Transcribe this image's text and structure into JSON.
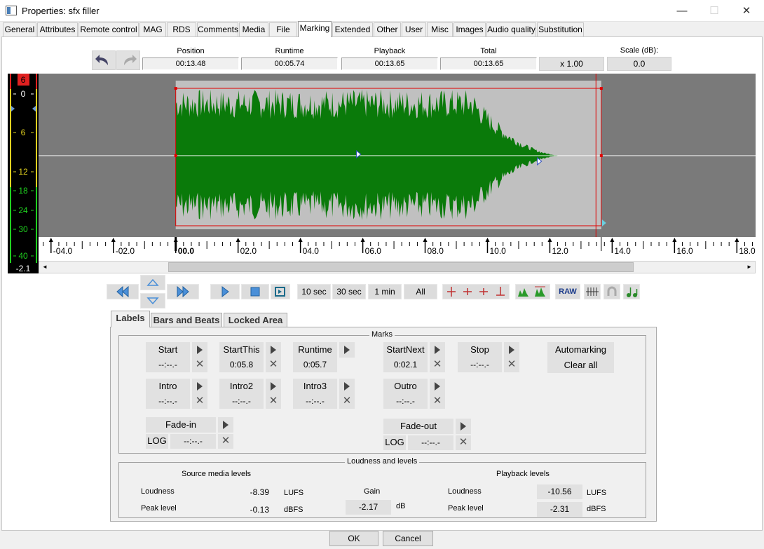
{
  "window": {
    "title": "Properties: sfx filler",
    "min_glyph": "—",
    "max_glyph": "☐",
    "close_glyph": "✕"
  },
  "tabs": [
    "General",
    "Attributes",
    "Remote control",
    "MAG",
    "RDS",
    "Comments",
    "Media",
    "File",
    "Marking",
    "Extended",
    "Other",
    "User",
    "Misc",
    "Images",
    "Audio quality",
    "Substitution"
  ],
  "active_tab": "Marking",
  "toolbar": {
    "undo_icon": "undo-arrow-icon",
    "redo_icon": "redo-arrow-icon",
    "position_label": "Position",
    "position_value": "00:13.48",
    "runtime_label": "Runtime",
    "runtime_value": "00:05.74",
    "playback_label": "Playback",
    "playback_value": "00:13.65",
    "total_label": "Total",
    "total_value": "00:13.65",
    "speed_value": "x 1.00",
    "scale_label": "Scale (dB):",
    "scale_value": "0.0"
  },
  "vu_meter": {
    "top_value": "6",
    "bottom_value": "-2.1",
    "ticks": [
      "0",
      "6",
      "12",
      "18",
      "24",
      "30",
      "40"
    ],
    "colors": {
      "top": "#e02020",
      "mid": "#e0d020",
      "low": "#20d020"
    }
  },
  "waveform": {
    "color": "#0a7a0a",
    "selection_color": "#c0c0c0",
    "outside_color": "#7a7a7a",
    "cursor_color": "#e00000",
    "selection_start_sec": 0.0,
    "selection_end_sec": 13.65,
    "cursor_sec": 13.48,
    "content_end_sec": 12.5,
    "markers_sec": [
      5.8,
      11.6
    ]
  },
  "ruler": {
    "labels": [
      "-04.0",
      "-02.0",
      "00.0",
      "02.0",
      "04.0",
      "06.0",
      "08.0",
      "10.0",
      "12.0",
      "14.0",
      "16.0",
      "18.0"
    ],
    "range_sec": [
      -4.4,
      18.6
    ]
  },
  "scrollbar": {
    "left_arrow": "◄",
    "right_arrow": "►",
    "thumb_start": 0.17,
    "thumb_end": 0.84
  },
  "transport": {
    "rewind_icon": "skip-back-icon",
    "up_icon": "zoom-up-icon",
    "down_icon": "zoom-down-icon",
    "forward_icon": "skip-forward-icon",
    "play_icon": "play-icon",
    "stop_icon": "stop-icon",
    "loop_icon": "loop-play-icon",
    "zoom_buttons": [
      "10 sec",
      "30 sec",
      "1 min",
      "All"
    ],
    "raw_label": "RAW"
  },
  "subtabs": [
    "Labels",
    "Bars and Beats",
    "Locked Area"
  ],
  "active_subtab": "Labels",
  "marks": {
    "group_title": "Marks",
    "items": [
      {
        "label": "Start",
        "value": "--:--.-"
      },
      {
        "label": "StartThis",
        "value": "0:05.8"
      },
      {
        "label": "Runtime",
        "value": "0:05.7"
      },
      {
        "label": "StartNext",
        "value": "0:02.1"
      },
      {
        "label": "Stop",
        "value": "--:--.-"
      },
      {
        "label": "Intro",
        "value": "--:--.-"
      },
      {
        "label": "Intro2",
        "value": "--:--.-"
      },
      {
        "label": "Intro3",
        "value": "--:--.-"
      },
      {
        "label": "Outro",
        "value": "--:--.-"
      },
      {
        "label": "Fade-in",
        "value": "--:--.-",
        "mode": "LOG"
      },
      {
        "label": "Fade-out",
        "value": "--:--.-",
        "mode": "LOG"
      }
    ],
    "automarking_label": "Automarking",
    "clear_all_label": "Clear all",
    "clear_glyph": "✕"
  },
  "loudness": {
    "group_title": "Loudness and levels",
    "source_title": "Source media levels",
    "loudness_label": "Loudness",
    "loudness_value": "-8.39",
    "loudness_unit": "LUFS",
    "peak_label": "Peak level",
    "peak_value": "-0.13",
    "peak_unit": "dBFS",
    "gain_label": "Gain",
    "gain_value": "-2.17",
    "gain_unit": "dB",
    "playback_title": "Playback levels",
    "pb_loudness_label": "Loudness",
    "pb_loudness_value": "-10.56",
    "pb_loudness_unit": "LUFS",
    "pb_peak_label": "Peak level",
    "pb_peak_value": "-2.31",
    "pb_peak_unit": "dBFS"
  },
  "footer": {
    "ok_label": "OK",
    "cancel_label": "Cancel"
  }
}
